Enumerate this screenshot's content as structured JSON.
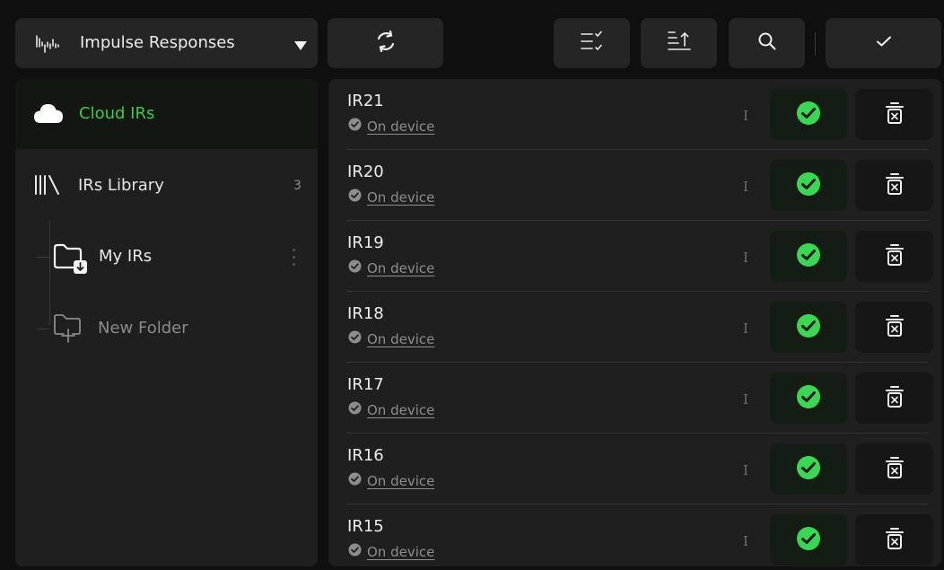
{
  "header": {
    "type_select": {
      "label": "Impulse Responses",
      "icon": "waveform-icon"
    },
    "sync_icon": "sync-icon",
    "multi_select_icon": "multi-select-icon",
    "sort_icon": "sort-icon",
    "search_icon": "search-icon",
    "done_icon": "checkmark-icon"
  },
  "sidebar": {
    "cloud": {
      "label": "Cloud IRs",
      "icon": "cloud-icon"
    },
    "library": {
      "label": "IRs Library",
      "count": "3",
      "icon": "library-icon"
    },
    "my_irs": {
      "label": "My IRs",
      "icon": "folder-download-icon"
    },
    "new_folder": {
      "label": "New Folder",
      "icon": "folder-add-icon"
    }
  },
  "list": {
    "items": [
      {
        "name": "IR21",
        "status": "On device",
        "marker": "I"
      },
      {
        "name": "IR20",
        "status": "On device",
        "marker": "I"
      },
      {
        "name": "IR19",
        "status": "On device",
        "marker": "I"
      },
      {
        "name": "IR18",
        "status": "On device",
        "marker": "I"
      },
      {
        "name": "IR17",
        "status": "On device",
        "marker": "I"
      },
      {
        "name": "IR16",
        "status": "On device",
        "marker": "I"
      },
      {
        "name": "IR15",
        "status": "On device",
        "marker": "I"
      }
    ]
  },
  "colors": {
    "accent": "#3ec84e",
    "check_fill": "#3cd655",
    "background": "#0f0f0f",
    "panel": "#1f1f1f",
    "button": "#252525"
  }
}
